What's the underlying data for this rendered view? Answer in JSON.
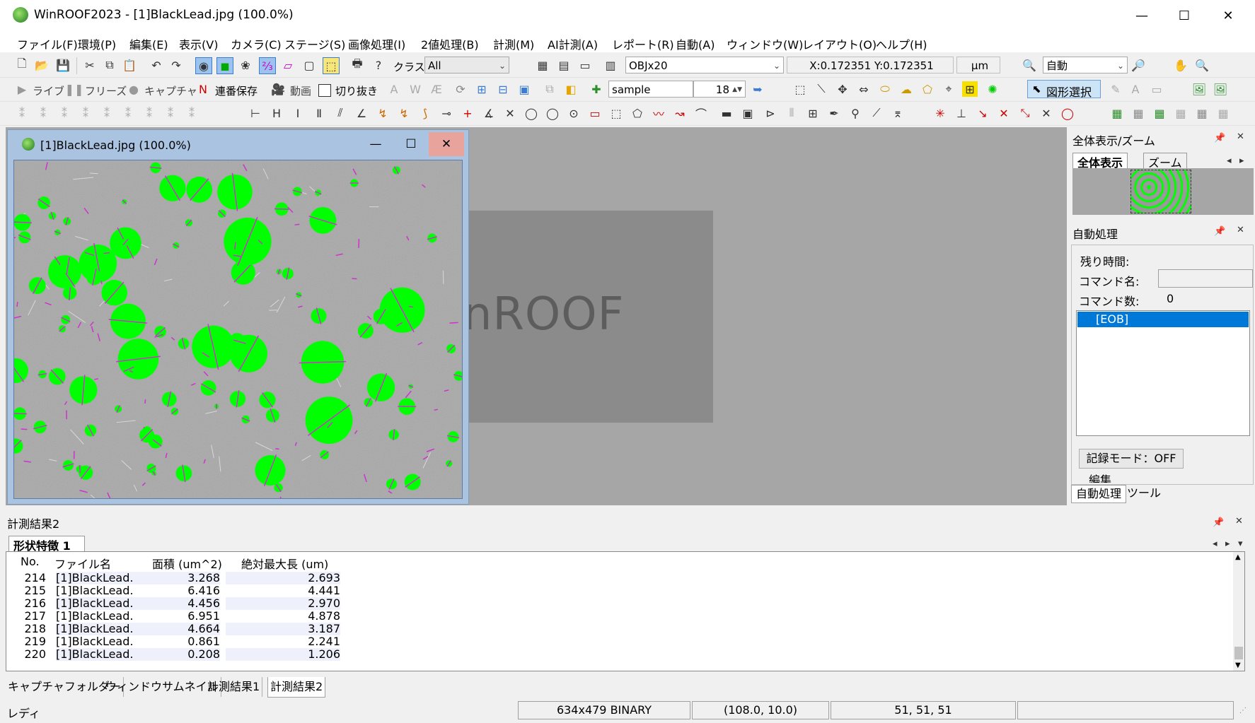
{
  "app": {
    "title": "WinROOF2023 - [1]BlackLead.jpg (100.0%)"
  },
  "menu": [
    "ファイル(F)",
    "環境(P)",
    "編集(E)",
    "表示(V)",
    "カメラ(C)",
    "ステージ(S)",
    "画像処理(I)",
    "2値処理(B)",
    "計測(M)",
    "AI計測(A)",
    "レポート(R)",
    "自動(A)",
    "ウィンドウ(W)",
    "レイアウト(O)",
    "ヘルプ(H)"
  ],
  "toolbar1": {
    "class_label": "クラス",
    "class_value": "All",
    "objective_value": "OBJx20",
    "coord_readout": "X:0.172351  Y:0.172351",
    "unit_value": "μm",
    "zoom_value": "自動"
  },
  "toolbar2": {
    "live_label": "ライブ",
    "freeze_label": "フリーズ",
    "capture_label": "キャプチャ",
    "serial_save_label": "連番保存",
    "movie_label": "動画",
    "crop_label": "切り抜き",
    "text_value": "sample",
    "font_size_value": "18",
    "select_shape_label": "図形選択"
  },
  "image_window": {
    "title": "[1]BlackLead.jpg (100.0%)"
  },
  "splash": {
    "text": "inROOF"
  },
  "overview_panel": {
    "title": "全体表示/ズーム",
    "tab_overview": "全体表示",
    "tab_zoom": "ズーム"
  },
  "auto_panel": {
    "title": "自動処理",
    "remaining_label": "残り時間:",
    "command_name_label": "コマンド名:",
    "command_count_label": "コマンド数:",
    "command_count_value": "0",
    "list_item": "[EOB]",
    "record_mode_button": "記録モード：OFF",
    "edit_label": "編集",
    "tab_auto": "自動処理",
    "tab_tool": "ツール"
  },
  "results": {
    "title": "計測結果2",
    "tab": "形状特徴 1",
    "columns": [
      "No.",
      "ファイル名",
      "面積 (um^2)",
      "絶対最大長 (um)"
    ],
    "rows": [
      [
        "214",
        "[1]BlackLead...",
        "3.268",
        "2.693"
      ],
      [
        "215",
        "[1]BlackLead...",
        "6.416",
        "4.441"
      ],
      [
        "216",
        "[1]BlackLead...",
        "4.456",
        "2.970"
      ],
      [
        "217",
        "[1]BlackLead...",
        "6.951",
        "4.878"
      ],
      [
        "218",
        "[1]BlackLead...",
        "4.664",
        "3.187"
      ],
      [
        "219",
        "[1]BlackLead...",
        "0.861",
        "2.241"
      ],
      [
        "220",
        "[1]BlackLead...",
        "0.208",
        "1.206"
      ]
    ]
  },
  "bottom_tabs": [
    "キャプチャフォルダー",
    "ウィンドウサムネイル",
    "計測結果1",
    "計測結果2"
  ],
  "status": {
    "ready": "レディ",
    "image_info": "634x479 BINARY",
    "position": "(108.0, 10.0)",
    "pixel_value": "51, 51, 51"
  },
  "colors": {
    "particle": "#00ff00",
    "outline": "#cc33cc",
    "selection": "#0078d7",
    "workspace": "#a6a6a6"
  }
}
